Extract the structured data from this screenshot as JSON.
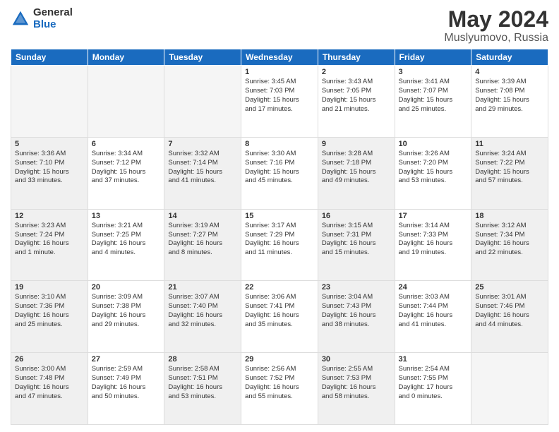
{
  "logo": {
    "general": "General",
    "blue": "Blue"
  },
  "title": "May 2024",
  "location": "Muslyumovo, Russia",
  "days_of_week": [
    "Sunday",
    "Monday",
    "Tuesday",
    "Wednesday",
    "Thursday",
    "Friday",
    "Saturday"
  ],
  "weeks": [
    [
      {
        "day": "",
        "info": "",
        "empty": true
      },
      {
        "day": "",
        "info": "",
        "empty": true
      },
      {
        "day": "",
        "info": "",
        "empty": true
      },
      {
        "day": "1",
        "info": "Sunrise: 3:45 AM\nSunset: 7:03 PM\nDaylight: 15 hours\nand 17 minutes."
      },
      {
        "day": "2",
        "info": "Sunrise: 3:43 AM\nSunset: 7:05 PM\nDaylight: 15 hours\nand 21 minutes."
      },
      {
        "day": "3",
        "info": "Sunrise: 3:41 AM\nSunset: 7:07 PM\nDaylight: 15 hours\nand 25 minutes."
      },
      {
        "day": "4",
        "info": "Sunrise: 3:39 AM\nSunset: 7:08 PM\nDaylight: 15 hours\nand 29 minutes."
      }
    ],
    [
      {
        "day": "5",
        "info": "Sunrise: 3:36 AM\nSunset: 7:10 PM\nDaylight: 15 hours\nand 33 minutes.",
        "shaded": true
      },
      {
        "day": "6",
        "info": "Sunrise: 3:34 AM\nSunset: 7:12 PM\nDaylight: 15 hours\nand 37 minutes."
      },
      {
        "day": "7",
        "info": "Sunrise: 3:32 AM\nSunset: 7:14 PM\nDaylight: 15 hours\nand 41 minutes.",
        "shaded": true
      },
      {
        "day": "8",
        "info": "Sunrise: 3:30 AM\nSunset: 7:16 PM\nDaylight: 15 hours\nand 45 minutes."
      },
      {
        "day": "9",
        "info": "Sunrise: 3:28 AM\nSunset: 7:18 PM\nDaylight: 15 hours\nand 49 minutes.",
        "shaded": true
      },
      {
        "day": "10",
        "info": "Sunrise: 3:26 AM\nSunset: 7:20 PM\nDaylight: 15 hours\nand 53 minutes."
      },
      {
        "day": "11",
        "info": "Sunrise: 3:24 AM\nSunset: 7:22 PM\nDaylight: 15 hours\nand 57 minutes.",
        "shaded": true
      }
    ],
    [
      {
        "day": "12",
        "info": "Sunrise: 3:23 AM\nSunset: 7:24 PM\nDaylight: 16 hours\nand 1 minute.",
        "shaded": true
      },
      {
        "day": "13",
        "info": "Sunrise: 3:21 AM\nSunset: 7:25 PM\nDaylight: 16 hours\nand 4 minutes."
      },
      {
        "day": "14",
        "info": "Sunrise: 3:19 AM\nSunset: 7:27 PM\nDaylight: 16 hours\nand 8 minutes.",
        "shaded": true
      },
      {
        "day": "15",
        "info": "Sunrise: 3:17 AM\nSunset: 7:29 PM\nDaylight: 16 hours\nand 11 minutes."
      },
      {
        "day": "16",
        "info": "Sunrise: 3:15 AM\nSunset: 7:31 PM\nDaylight: 16 hours\nand 15 minutes.",
        "shaded": true
      },
      {
        "day": "17",
        "info": "Sunrise: 3:14 AM\nSunset: 7:33 PM\nDaylight: 16 hours\nand 19 minutes."
      },
      {
        "day": "18",
        "info": "Sunrise: 3:12 AM\nSunset: 7:34 PM\nDaylight: 16 hours\nand 22 minutes.",
        "shaded": true
      }
    ],
    [
      {
        "day": "19",
        "info": "Sunrise: 3:10 AM\nSunset: 7:36 PM\nDaylight: 16 hours\nand 25 minutes.",
        "shaded": true
      },
      {
        "day": "20",
        "info": "Sunrise: 3:09 AM\nSunset: 7:38 PM\nDaylight: 16 hours\nand 29 minutes."
      },
      {
        "day": "21",
        "info": "Sunrise: 3:07 AM\nSunset: 7:40 PM\nDaylight: 16 hours\nand 32 minutes.",
        "shaded": true
      },
      {
        "day": "22",
        "info": "Sunrise: 3:06 AM\nSunset: 7:41 PM\nDaylight: 16 hours\nand 35 minutes."
      },
      {
        "day": "23",
        "info": "Sunrise: 3:04 AM\nSunset: 7:43 PM\nDaylight: 16 hours\nand 38 minutes.",
        "shaded": true
      },
      {
        "day": "24",
        "info": "Sunrise: 3:03 AM\nSunset: 7:44 PM\nDaylight: 16 hours\nand 41 minutes."
      },
      {
        "day": "25",
        "info": "Sunrise: 3:01 AM\nSunset: 7:46 PM\nDaylight: 16 hours\nand 44 minutes.",
        "shaded": true
      }
    ],
    [
      {
        "day": "26",
        "info": "Sunrise: 3:00 AM\nSunset: 7:48 PM\nDaylight: 16 hours\nand 47 minutes.",
        "shaded": true
      },
      {
        "day": "27",
        "info": "Sunrise: 2:59 AM\nSunset: 7:49 PM\nDaylight: 16 hours\nand 50 minutes."
      },
      {
        "day": "28",
        "info": "Sunrise: 2:58 AM\nSunset: 7:51 PM\nDaylight: 16 hours\nand 53 minutes.",
        "shaded": true
      },
      {
        "day": "29",
        "info": "Sunrise: 2:56 AM\nSunset: 7:52 PM\nDaylight: 16 hours\nand 55 minutes."
      },
      {
        "day": "30",
        "info": "Sunrise: 2:55 AM\nSunset: 7:53 PM\nDaylight: 16 hours\nand 58 minutes.",
        "shaded": true
      },
      {
        "day": "31",
        "info": "Sunrise: 2:54 AM\nSunset: 7:55 PM\nDaylight: 17 hours\nand 0 minutes."
      },
      {
        "day": "",
        "info": "",
        "empty": true
      }
    ]
  ]
}
